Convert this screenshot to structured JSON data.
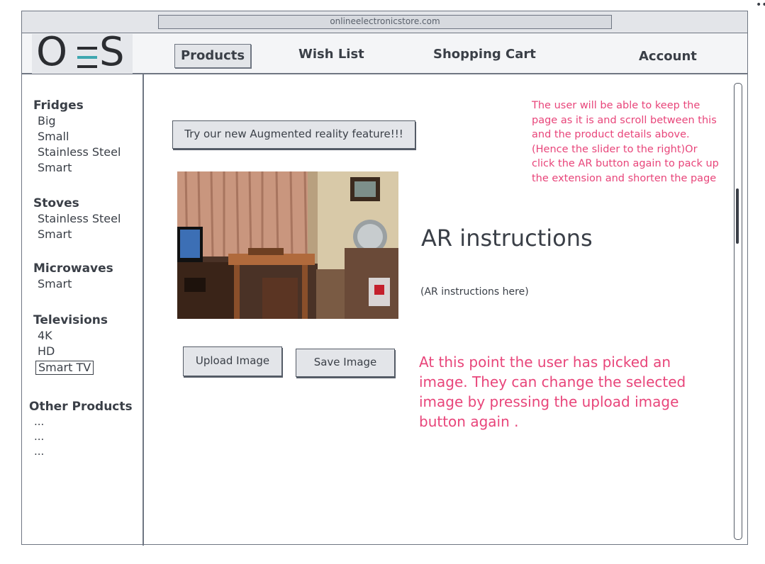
{
  "browser": {
    "url": "onlineelectronicstore.com"
  },
  "logo": {
    "left": "O",
    "right": "S"
  },
  "nav": {
    "products": "Products",
    "wishlist": "Wish List",
    "cart": "Shopping Cart",
    "account": "Account"
  },
  "sidebar": {
    "categories": [
      {
        "title": "Fridges",
        "items": [
          "Big",
          "Small",
          "Stainless Steel",
          "Smart"
        ]
      },
      {
        "title": "Stoves",
        "items": [
          "Stainless Steel",
          "Smart"
        ]
      },
      {
        "title": "Microwaves",
        "items": [
          "Smart"
        ]
      },
      {
        "title": "Televisions",
        "items": [
          "4K",
          "HD",
          "Smart TV"
        ]
      }
    ],
    "other": {
      "title": "Other Products",
      "items": [
        "...",
        "...",
        "..."
      ]
    }
  },
  "main": {
    "ar_button": "Try our new Augmented reality feature!!!",
    "ar_title": "AR instructions",
    "ar_body": "(AR instructions here)",
    "upload_button": "Upload Image",
    "save_button": "Save Image",
    "note_top": "The user will be able to keep the page as it is and scroll between this and the product details above. (Hence the slider to the right)Or click the AR button again to pack up the extension and shorten the page",
    "note_bottom": "At this point the user has picked an image. They can change the selected image by pressing the upload image button again ."
  },
  "colors": {
    "annotation": "#e8457a",
    "border": "#6f7682",
    "logo_accent": "#3fa7b0"
  },
  "corner": "••"
}
